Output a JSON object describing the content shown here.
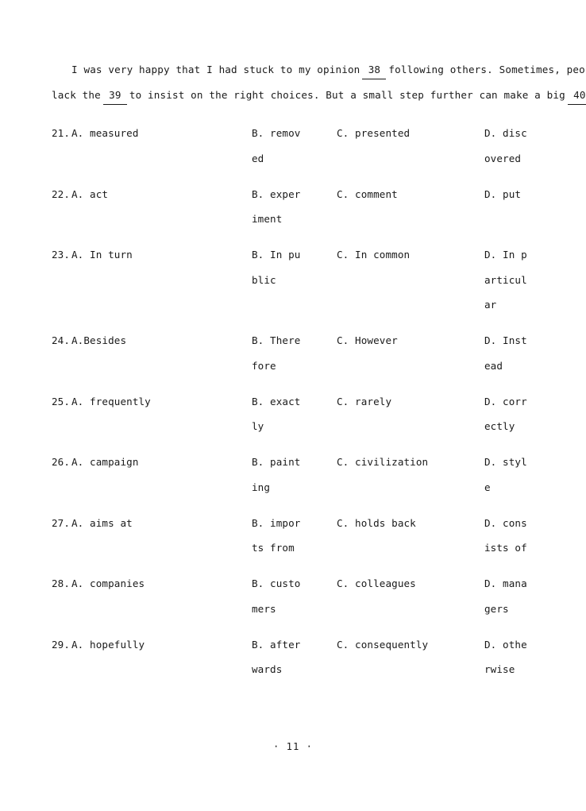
{
  "passage": {
    "lines": [
      {
        "indent": true,
        "segments": [
          {
            "type": "text",
            "text": "I was very happy that I had stuck to my opinion"
          },
          {
            "type": "blank",
            "text": "38"
          },
          {
            "type": "text",
            "text": "following others. Sometimes, people"
          }
        ]
      },
      {
        "indent": false,
        "segments": [
          {
            "type": "text",
            "text": "lack the"
          },
          {
            "type": "blank",
            "text": "39"
          },
          {
            "type": "text",
            "text": "to insist on the right choices. But a small step further can make a big"
          },
          {
            "type": "blank",
            "text": "40"
          },
          {
            "type": "text",
            "text": "."
          }
        ]
      }
    ]
  },
  "questions": [
    {
      "number": "21.",
      "a": "A.  measured",
      "b": "B.  removed",
      "c": "C.  presented",
      "d": "D.  discovered"
    },
    {
      "number": "22.",
      "a": "A.  act",
      "b": "B.  experiment",
      "c": "C.  comment",
      "d": "D.  put"
    },
    {
      "number": "23.",
      "a": "A.  In turn",
      "b": "B.  In public",
      "c": "C.  In common",
      "d": "D.  In particular"
    },
    {
      "number": "24.",
      "a": "A.Besides",
      "b": "B.  Therefore",
      "c": "C.  However",
      "d": "D.  Instead"
    },
    {
      "number": "25.",
      "a": "A.  frequently",
      "b": "B.  exactly",
      "c": "C.  rarely",
      "d": "D.  correctly"
    },
    {
      "number": "26.",
      "a": "A.  campaign",
      "b": "B.  painting",
      "c": "C.  civilization",
      "d": "D.  style"
    },
    {
      "number": "27.",
      "a": "A.  aims at",
      "b": "B.  imports from",
      "c": "C.  holds back",
      "d": "D.  consists of"
    },
    {
      "number": "28.",
      "a": "A.  companies",
      "b": "B.  customers",
      "c": "C.  colleagues",
      "d": "D.  managers"
    },
    {
      "number": "29.",
      "a": "A.  hopefully",
      "b": "B.  afterwards",
      "c": "C.  consequently",
      "d": "D.  otherwise"
    }
  ],
  "footer": {
    "page_label": "· 11 ·"
  }
}
